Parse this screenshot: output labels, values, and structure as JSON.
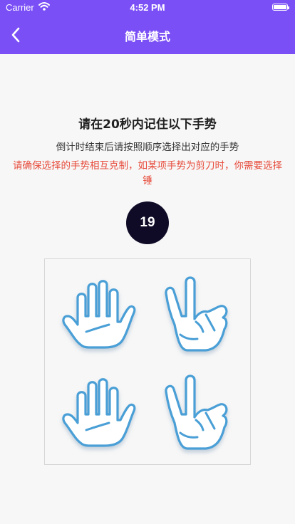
{
  "status_bar": {
    "carrier": "Carrier",
    "time": "4:52 PM"
  },
  "nav": {
    "title": "简单模式",
    "back_icon": "chevron-left-icon"
  },
  "instructions": {
    "headline": "请在20秒内记住以下手势",
    "subline": "倒计时结束后请按照顺序选择出对应的手势",
    "warning": "请确保选择的手势相互克制，如某项手势为剪刀时，你需要选择锤"
  },
  "countdown": {
    "value": "19"
  },
  "gestures": [
    {
      "type": "paper",
      "icon": "open-hand-icon"
    },
    {
      "type": "scissors",
      "icon": "victory-hand-icon"
    },
    {
      "type": "paper",
      "icon": "open-hand-icon"
    },
    {
      "type": "scissors",
      "icon": "victory-hand-icon"
    }
  ],
  "colors": {
    "nav_bg": "#7b4ff6",
    "warning_text": "#e74c3c",
    "countdown_bg": "#0f0a26",
    "hand_stroke": "#4a9fd6"
  }
}
